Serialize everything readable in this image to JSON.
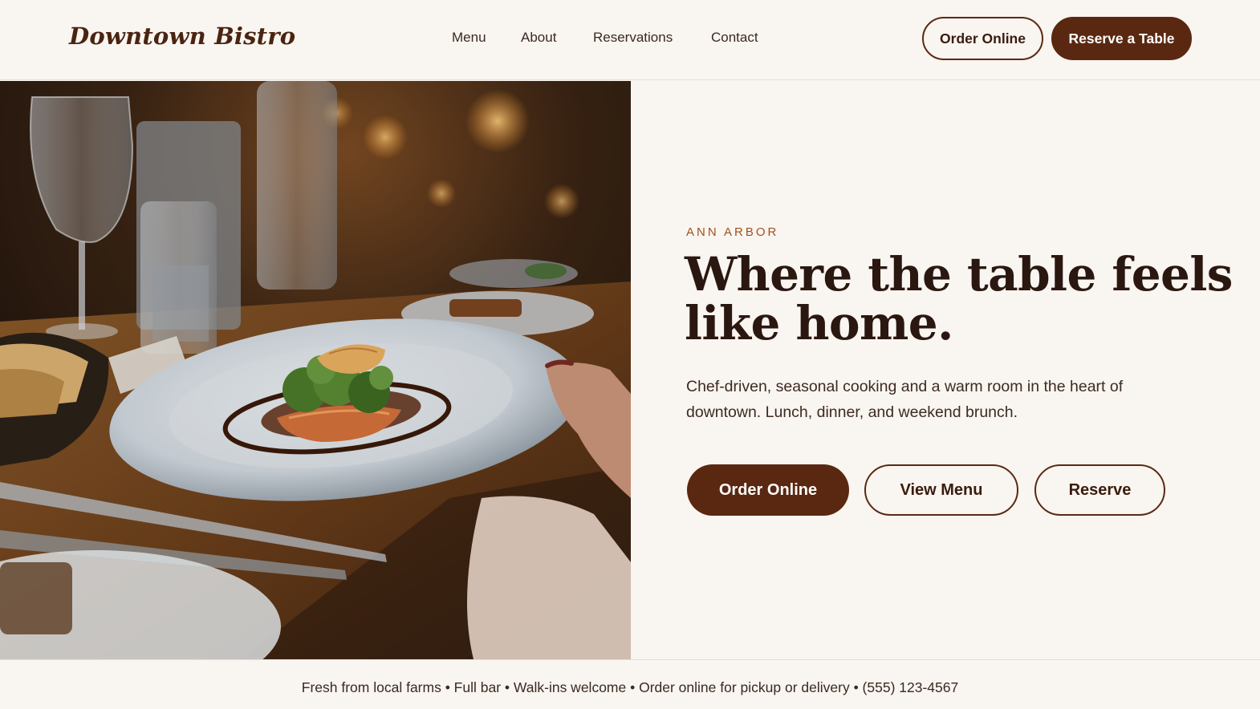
{
  "brand": {
    "name": "Downtown Bistro",
    "colors": {
      "primary": "#5a2810",
      "accent": "#a0521e",
      "background": "#f9f5f1"
    }
  },
  "nav": {
    "items": [
      {
        "label": "Menu"
      },
      {
        "label": "About"
      },
      {
        "label": "Reservations"
      },
      {
        "label": "Contact"
      }
    ]
  },
  "header_actions": {
    "order_online": "Order Online",
    "reserve_table": "Reserve a Table"
  },
  "hero": {
    "eyebrow": "ANN ARBOR",
    "headline": "Where the table feels like home.",
    "subtext": "Chef-driven, seasonal cooking and a warm room in the heart of downtown. Lunch, dinner, and weekend brunch.",
    "cta": {
      "order_online": "Order Online",
      "view_menu": "View Menu",
      "reserve": "Reserve"
    }
  },
  "info_strip": "Fresh from local farms • Full bar • Walk-ins welcome • Order online for pickup or delivery • (555) 123-4567"
}
